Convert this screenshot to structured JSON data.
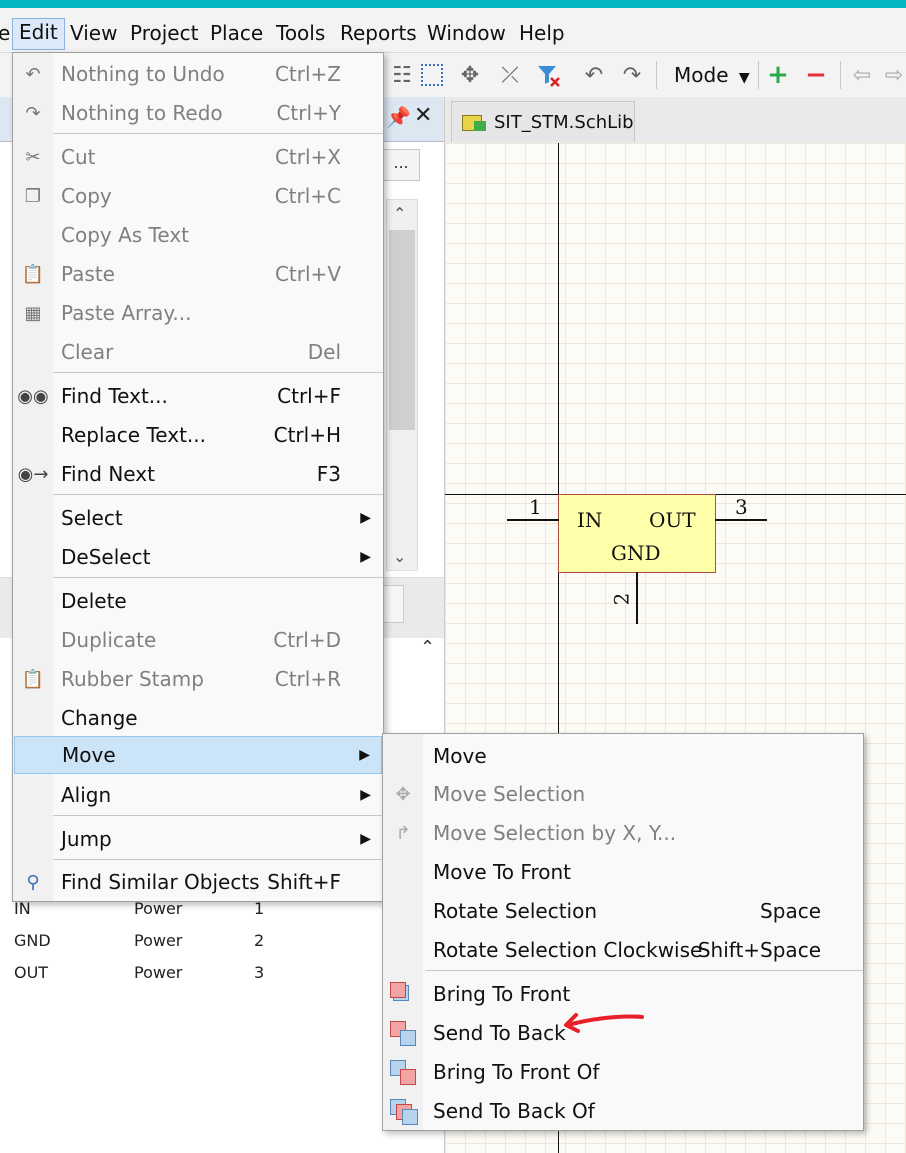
{
  "menubar": {
    "items": [
      {
        "label": "e"
      },
      {
        "label": "Edit"
      },
      {
        "label": "View"
      },
      {
        "label": "Project"
      },
      {
        "label": "Place"
      },
      {
        "label": "Tools"
      },
      {
        "label": "Reports"
      },
      {
        "label": "Window"
      },
      {
        "label": "Help"
      }
    ]
  },
  "toolbar": {
    "mode_label": "Mode",
    "icons": [
      "undo-icon",
      "redo-icon",
      "select-rect-icon",
      "move-icon",
      "cross-probe-icon",
      "filter-clear-icon",
      "add-icon",
      "remove-icon",
      "nav-left-icon",
      "nav-right-icon"
    ]
  },
  "left_panel": {
    "dots_label": "...",
    "pins": [
      {
        "name": "IN",
        "type": "Power",
        "num": "1"
      },
      {
        "name": "GND",
        "type": "Power",
        "num": "2"
      },
      {
        "name": "OUT",
        "type": "Power",
        "num": "3"
      }
    ]
  },
  "document_tab": {
    "label": "SIT_STM.SchLib"
  },
  "part": {
    "pin_in": "IN",
    "pin_out": "OUT",
    "pin_gnd": "GND",
    "num_1": "1",
    "num_2": "2",
    "num_3": "3"
  },
  "edit_menu": {
    "items": [
      {
        "label": "Nothing to Undo",
        "shortcut": "Ctrl+Z"
      },
      {
        "label": "Nothing to Redo",
        "shortcut": "Ctrl+Y"
      },
      {
        "label": "Cut",
        "shortcut": "Ctrl+X"
      },
      {
        "label": "Copy",
        "shortcut": "Ctrl+C"
      },
      {
        "label": "Copy As Text",
        "shortcut": ""
      },
      {
        "label": "Paste",
        "shortcut": "Ctrl+V"
      },
      {
        "label": "Paste Array...",
        "shortcut": ""
      },
      {
        "label": "Clear",
        "shortcut": "Del"
      },
      {
        "label": "Find Text...",
        "shortcut": "Ctrl+F"
      },
      {
        "label": "Replace Text...",
        "shortcut": "Ctrl+H"
      },
      {
        "label": "Find Next",
        "shortcut": "F3"
      },
      {
        "label": "Select",
        "shortcut": ""
      },
      {
        "label": "DeSelect",
        "shortcut": ""
      },
      {
        "label": "Delete",
        "shortcut": ""
      },
      {
        "label": "Duplicate",
        "shortcut": "Ctrl+D"
      },
      {
        "label": "Rubber Stamp",
        "shortcut": "Ctrl+R"
      },
      {
        "label": "Change",
        "shortcut": ""
      },
      {
        "label": "Move",
        "shortcut": ""
      },
      {
        "label": "Align",
        "shortcut": ""
      },
      {
        "label": "Jump",
        "shortcut": ""
      },
      {
        "label": "Find Similar Objects",
        "shortcut": "Shift+F"
      }
    ]
  },
  "move_submenu": {
    "items": [
      {
        "label": "Move",
        "shortcut": ""
      },
      {
        "label": "Move Selection",
        "shortcut": ""
      },
      {
        "label": "Move Selection by X, Y...",
        "shortcut": ""
      },
      {
        "label": "Move To Front",
        "shortcut": ""
      },
      {
        "label": "Rotate Selection",
        "shortcut": "Space"
      },
      {
        "label": "Rotate Selection Clockwise",
        "shortcut": "Shift+Space"
      },
      {
        "label": "Bring To Front",
        "shortcut": ""
      },
      {
        "label": "Send To Back",
        "shortcut": ""
      },
      {
        "label": "Bring To Front Of",
        "shortcut": ""
      },
      {
        "label": "Send To Back Of",
        "shortcut": ""
      }
    ]
  },
  "colors": {
    "title_accent": "#00b7c3",
    "highlight": "#cce4f7",
    "part_fill": "#ffffaa",
    "annotation_arrow": "#e8202a"
  }
}
